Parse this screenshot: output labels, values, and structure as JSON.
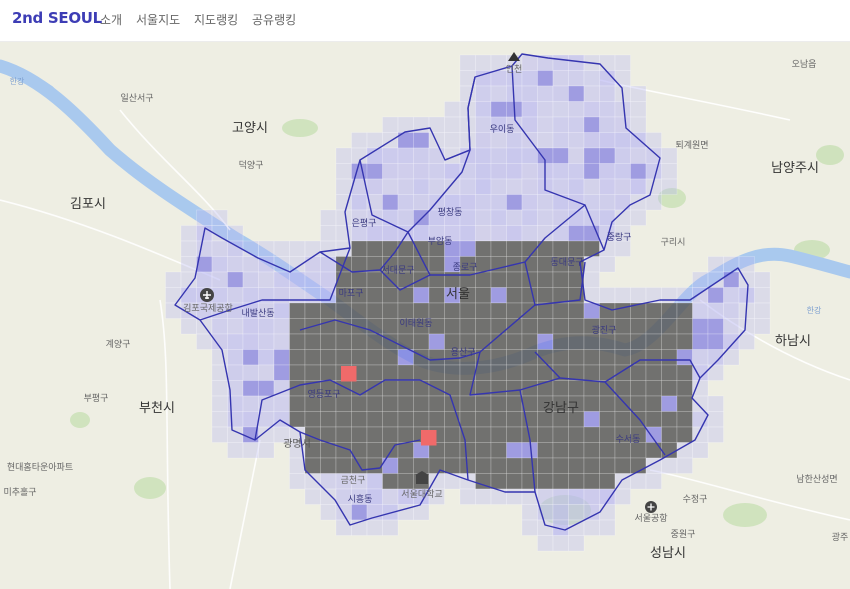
{
  "header": {
    "logo": "2nd SEOUL",
    "nav": [
      "소개",
      "서울지도",
      "지도랭킹",
      "공유랭킹"
    ]
  },
  "colors": {
    "accent": "#3d3db5",
    "visited_dark": "#5a5a5a",
    "highlight": "#f06a6a",
    "grid_light": "#b8b6f2",
    "boundary": "#3535b0",
    "river": "#a9c9ee",
    "land": "#eeeee3"
  },
  "map": {
    "labels": {
      "cities": [
        "고양시",
        "김포시",
        "남양주시",
        "하남시",
        "부천시",
        "성남시",
        "서울"
      ],
      "areas": [
        "오남읍",
        "일산서구",
        "덕양구",
        "퇴계원면",
        "계양구",
        "부평구",
        "현대홈타운아파트",
        "미추홀구",
        "남한산성면",
        "수정구",
        "중원구",
        "광주",
        "구리시",
        "광명시",
        "금천구"
      ],
      "districts": [
        "우이동",
        "평창동",
        "은평구",
        "부암동",
        "종로구",
        "동대문구",
        "중랑구",
        "서대문구",
        "마포구",
        "광진구",
        "용산구",
        "이태원동",
        "강남구",
        "수서동",
        "시흥동",
        "서울대학교",
        "영등포구",
        "김포국제공항",
        "내발산동",
        "인천"
      ],
      "rivers": [
        "한강",
        "한강"
      ],
      "places": [
        "서울공항"
      ]
    },
    "icons": [
      "airport-icon",
      "airport-icon",
      "university-icon",
      "mountain-icon"
    ]
  }
}
